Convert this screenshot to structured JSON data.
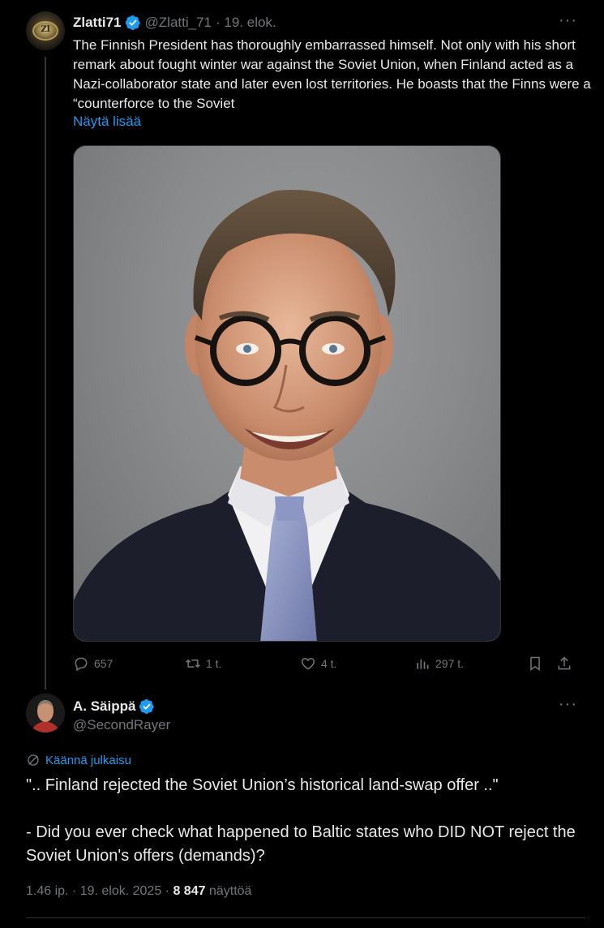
{
  "tweet1": {
    "display_name": "Zlatti71",
    "handle": "@Zlatti_71",
    "date": "· 19. elok.",
    "text": "The Finnish President has thoroughly embarrassed himself. Not only with his short remark about fought winter war against the Soviet Union, when Finland acted as a Nazi-collaborator state and later even lost territories. He boasts that the Finns were a “counterforce to the Soviet",
    "show_more": "Näytä lisää",
    "avatar_icon": "coin-icon",
    "avatar_text": "Zl",
    "replies": "657",
    "reposts": "1 t.",
    "likes": "4 t.",
    "views": "297 t."
  },
  "tweet2": {
    "display_name": "A. Säippä",
    "handle": "@SecondRayer",
    "translate_label": "Käännä julkaisu",
    "line1": "\".. Finland rejected the Soviet Union’s historical land-swap offer ..\"",
    "line2": "- Did you ever check what happened to Baltic states who DID NOT reject the Soviet Union's offers (demands)?",
    "time": "1.46 ip. · 19. elok. 2025 ·",
    "views_count": "8 847",
    "views_label": "näyttöä"
  },
  "colors": {
    "background": "#000000",
    "text": "#e7e9ea",
    "muted": "#71767b",
    "accent": "#1d9bf0"
  }
}
